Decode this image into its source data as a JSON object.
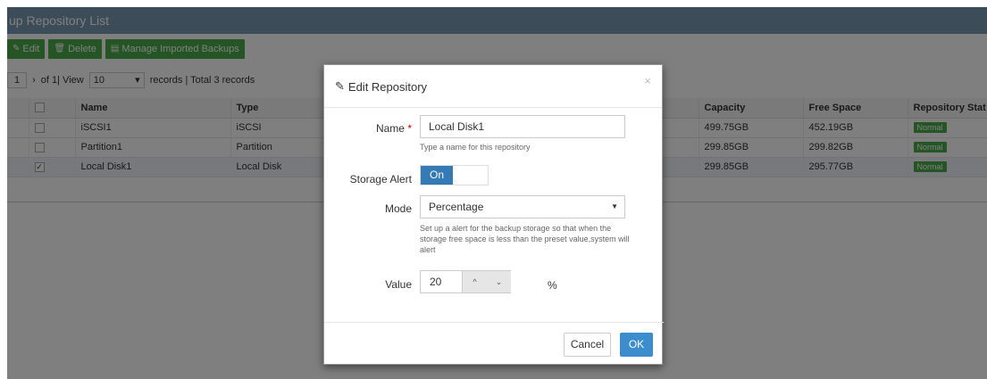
{
  "page": {
    "title": "up Repository List",
    "toolbar": {
      "edit_label": "Edit",
      "delete_label": "Delete",
      "manage_label": "Manage Imported Backups"
    },
    "pager": {
      "current_page": "1",
      "of_text": "of 1| View",
      "per_page": "10",
      "records_text": "records | Total 3 records"
    },
    "table": {
      "columns": [
        "Name",
        "Type",
        "Capacity",
        "Free Space",
        "Repository Stat"
      ],
      "rows": [
        {
          "name": "iSCSI1",
          "type": "iSCSI",
          "capacity": "499.75GB",
          "free": "452.19GB",
          "status": "Normal",
          "checked": false
        },
        {
          "name": "Partition1",
          "type": "Partition",
          "capacity": "299.85GB",
          "free": "299.82GB",
          "status": "Normal",
          "checked": false
        },
        {
          "name": "Local Disk1",
          "type": "Local Disk",
          "capacity": "299.85GB",
          "free": "295.77GB",
          "status": "Normal",
          "checked": true
        }
      ]
    }
  },
  "modal": {
    "title": "Edit Repository",
    "close": "×",
    "name_label": "Name",
    "name_required": "*",
    "name_value": "Local Disk1",
    "name_help": "Type a name for this repository",
    "alert_label": "Storage Alert",
    "alert_toggle": "On",
    "mode_label": "Mode",
    "mode_value": "Percentage",
    "mode_help": "Set up a alert for the backup storage so that when the storage free space is less than the preset value,system will alert",
    "value_label": "Value",
    "value": "20",
    "unit": "%",
    "cancel_label": "Cancel",
    "ok_label": "OK"
  },
  "colors": {
    "title_bar": "#7b98b2",
    "accent_green": "#4aaa4a",
    "primary_blue": "#3c8dcd"
  }
}
